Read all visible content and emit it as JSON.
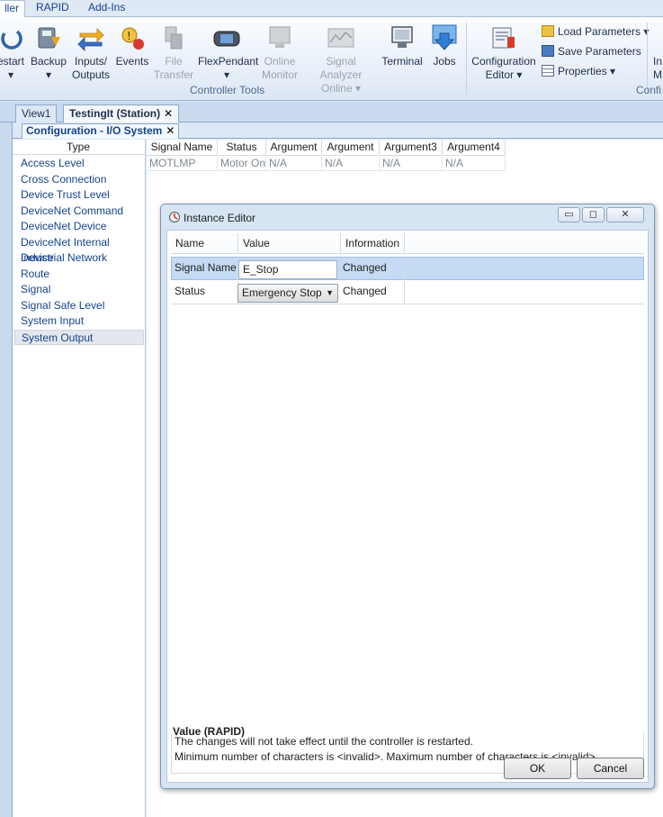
{
  "menu": {
    "tabs": [
      "ller",
      "RAPID",
      "Add-Ins"
    ]
  },
  "ribbon": {
    "buttons": [
      {
        "label": "estart",
        "sub": "▾",
        "icon": "restart-icon"
      },
      {
        "label": "Backup",
        "sub": "▾",
        "icon": "backup-icon"
      },
      {
        "label": "Inputs/",
        "sub": "Outputs",
        "icon": "inputs-outputs-icon"
      },
      {
        "label": "Events",
        "sub": "",
        "icon": "events-icon"
      },
      {
        "label": "File",
        "sub": "Transfer",
        "icon": "file-transfer-icon"
      },
      {
        "label": "FlexPendant",
        "sub": "▾",
        "icon": "flexpendant-icon"
      },
      {
        "label": "Online",
        "sub": "Monitor",
        "icon": "online-monitor-icon"
      },
      {
        "label": "Signal Analyzer",
        "sub": "Online ▾",
        "icon": "signal-analyzer-icon"
      },
      {
        "label": "Terminal",
        "sub": "",
        "icon": "terminal-icon"
      },
      {
        "label": "Jobs",
        "sub": "",
        "icon": "jobs-icon"
      },
      {
        "label": "Configuration",
        "sub": "Editor ▾",
        "icon": "configuration-editor-icon"
      }
    ],
    "small_buttons": [
      "Load Parameters ▾",
      "Save Parameters",
      "Properties ▾"
    ],
    "group_label": "Controller Tools",
    "group_label_right": "Confi",
    "cut_button": {
      "top": "In",
      "bottom": "M"
    }
  },
  "tabs": {
    "view1": "View1",
    "station": "TestingIt (Station)",
    "config": "Configuration - I/O System",
    "close": "✕"
  },
  "types": {
    "header": "Type",
    "items": [
      "Access Level",
      "Cross Connection",
      "Device Trust Level",
      "DeviceNet Command",
      "DeviceNet Device",
      "DeviceNet Internal Device",
      "Industrial Network",
      "Route",
      "Signal",
      "Signal Safe Level",
      "System Input",
      "System Output"
    ],
    "selected": "System Output"
  },
  "grid": {
    "columns": [
      "Signal Name",
      "Status",
      "Argument",
      "Argument",
      "Argument3",
      "Argument4"
    ],
    "rows": [
      [
        "MOTLMP",
        "Motor On",
        "N/A",
        "N/A",
        "N/A",
        "N/A"
      ]
    ]
  },
  "dialog": {
    "title": "Instance Editor",
    "columns": [
      "Name",
      "Value",
      "Information"
    ],
    "rows": [
      {
        "name": "Signal Name",
        "value": "E_Stop",
        "info": "Changed"
      },
      {
        "name": "Status",
        "value": "Emergency Stop",
        "info": "Changed"
      }
    ],
    "description_title": "Value (RAPID)",
    "description_lines": [
      "The changes will not take effect until the controller is restarted.",
      "Minimum number of characters is <invalid>. Maximum number of characters is <invalid>."
    ],
    "ok": "OK",
    "cancel": "Cancel"
  }
}
